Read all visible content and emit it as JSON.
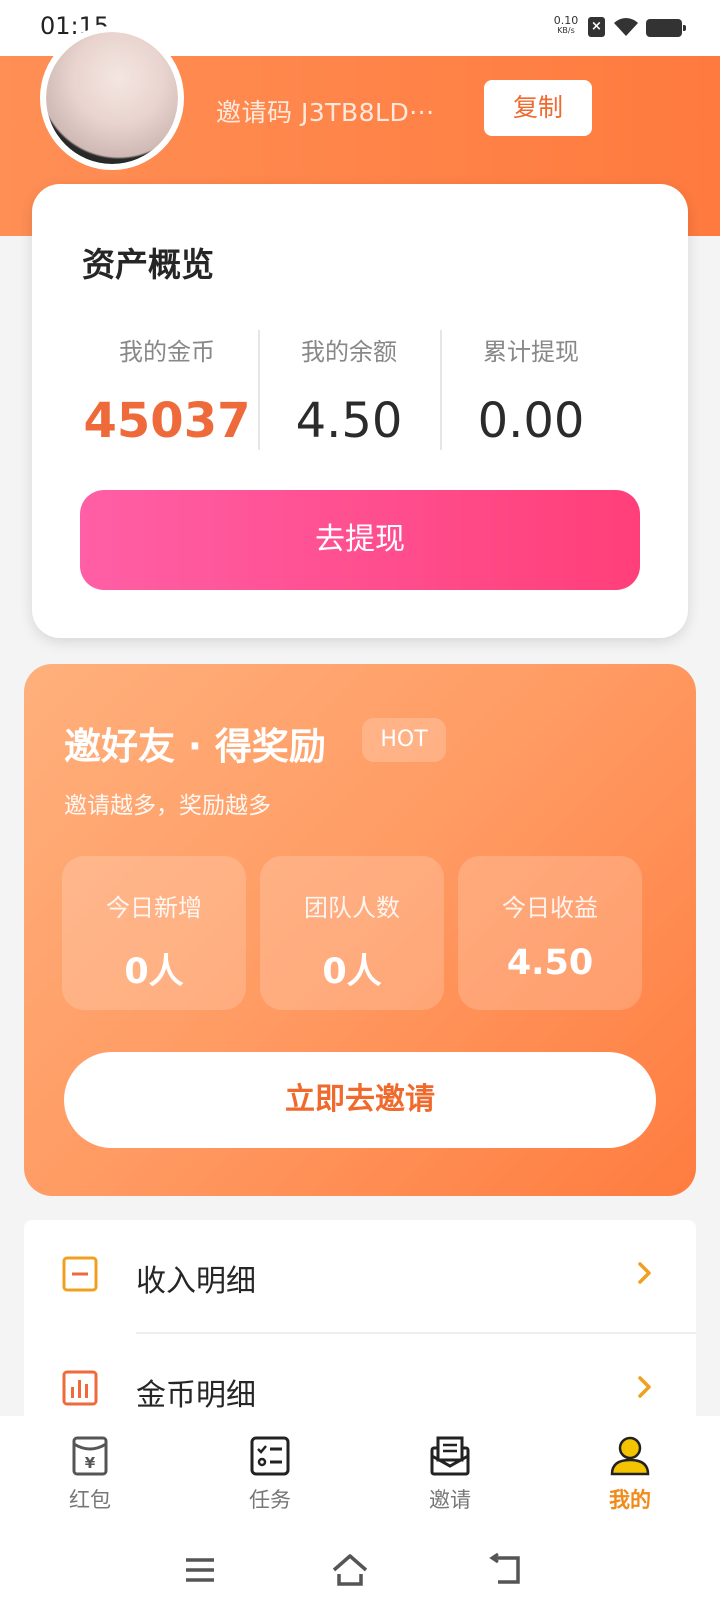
{
  "status_bar": {
    "time": "01:15",
    "net_speed_value": "0.10",
    "net_speed_unit": "KB/s",
    "sim_icon": "sim-disabled-icon",
    "wifi_icon": "wifi-icon",
    "battery_icon": "battery-icon"
  },
  "header": {
    "invite_code_text": "邀请码 J3TB8LD···",
    "copy_label": "复制",
    "colors": {
      "gradient_start": "#ff8f55",
      "gradient_end": "#ff7a3e"
    }
  },
  "assets": {
    "title": "资产概览",
    "columns": [
      {
        "label": "我的金币",
        "value": "45037"
      },
      {
        "label": "我的余额",
        "value": "4.50"
      },
      {
        "label": "累计提现",
        "value": "0.00"
      }
    ],
    "withdraw_label": "去提现",
    "colors": {
      "coin_value": "#ef6a3a",
      "button_start": "#ff5fa6",
      "button_end": "#ff3f79"
    }
  },
  "invite": {
    "title": "邀好友 · 得奖励",
    "badge": "HOT",
    "subtitle": "邀请越多，奖励越多",
    "stats": [
      {
        "label": "今日新增",
        "value": "0人"
      },
      {
        "label": "团队人数",
        "value": "0人"
      },
      {
        "label": "今日收益",
        "value": "4.50"
      }
    ],
    "invite_button_label": "立即去邀请"
  },
  "menu": {
    "items": [
      {
        "label": "收入明细",
        "icon": "income-detail-icon"
      },
      {
        "label": "金币明细",
        "icon": "coin-chart-icon"
      }
    ]
  },
  "bottom_nav": {
    "items": [
      {
        "label": "红包",
        "icon": "red-packet-icon",
        "active": false
      },
      {
        "label": "任务",
        "icon": "task-list-icon",
        "active": false
      },
      {
        "label": "邀请",
        "icon": "invite-envelope-icon",
        "active": false
      },
      {
        "label": "我的",
        "icon": "user-profile-icon",
        "active": true
      }
    ],
    "active_color": "#f08a18"
  },
  "system_nav": {
    "menu_icon": "menu-icon",
    "home_icon": "home-icon",
    "back_icon": "back-icon"
  }
}
